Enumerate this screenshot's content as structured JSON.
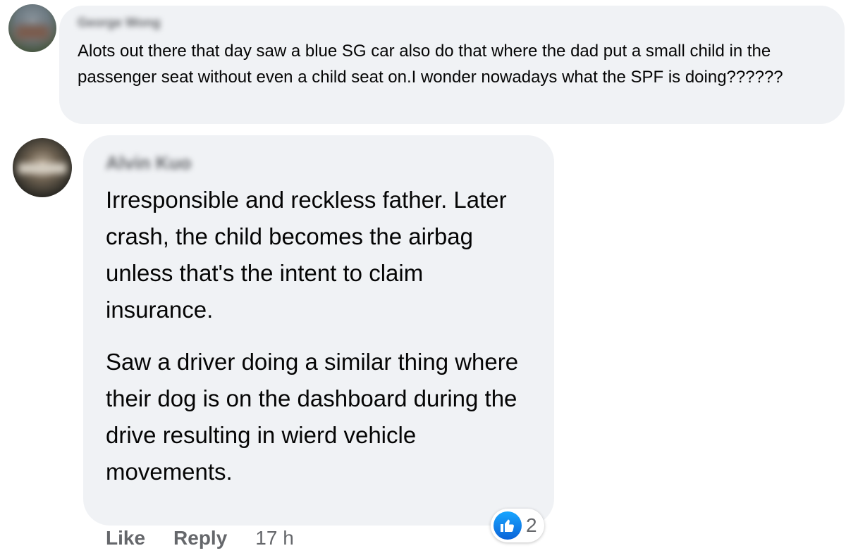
{
  "comments": [
    {
      "author": "George Wong",
      "text": "Alots out there that day saw a blue SG car also do that where the dad put a small child in the passenger seat without even a child seat on.I wonder nowadays what the SPF is doing??????"
    },
    {
      "author": "Alvin Kuo",
      "paragraphs": [
        "Irresponsible and reckless father. Later crash, the child becomes the airbag unless that's the intent to claim insurance.",
        "Saw a driver doing a similar thing where their dog is on the dashboard during the drive resulting in wierd vehicle movements."
      ],
      "reaction": {
        "icon": "thumbs-up-icon",
        "count": "2",
        "color": "#1877f2"
      },
      "actions": {
        "like": "Like",
        "reply": "Reply",
        "time": "17 h"
      }
    }
  ],
  "colors": {
    "bubble": "#f0f2f5",
    "text": "#050505",
    "secondary": "#65676b"
  }
}
